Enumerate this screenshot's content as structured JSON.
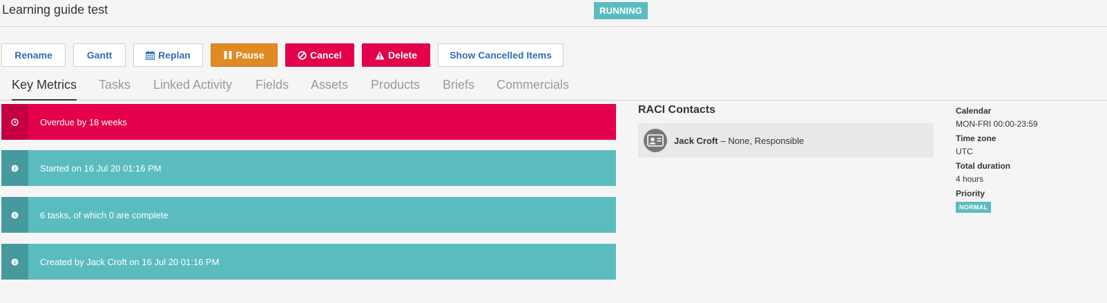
{
  "header": {
    "title": "Learning guide test",
    "status": "RUNNING"
  },
  "toolbar": {
    "rename": "Rename",
    "gantt": "Gantt",
    "replan": "Replan",
    "pause": "Pause",
    "cancel": "Cancel",
    "delete": "Delete",
    "show_cancelled": "Show Cancelled Items"
  },
  "tabs": [
    {
      "label": "Key Metrics",
      "active": true
    },
    {
      "label": "Tasks"
    },
    {
      "label": "Linked Activity"
    },
    {
      "label": "Fields"
    },
    {
      "label": "Assets"
    },
    {
      "label": "Products"
    },
    {
      "label": "Briefs"
    },
    {
      "label": "Commercials"
    }
  ],
  "metrics": [
    {
      "text": "Overdue by 18 weeks",
      "kind": "danger",
      "icon": "clock-icon"
    },
    {
      "text": "Started on 16 Jul 20 01:16 PM",
      "kind": "info",
      "icon": "info-icon"
    },
    {
      "text": "6 tasks, of which 0 are complete",
      "kind": "info",
      "icon": "info-icon"
    },
    {
      "text": "Created by Jack Croft on 16 Jul 20 01:16 PM",
      "kind": "info",
      "icon": "info-icon"
    }
  ],
  "raci": {
    "title": "RACI Contacts",
    "contact_name": "Jack Croft",
    "contact_role": "– None, Responsible"
  },
  "details": {
    "calendar_label": "Calendar",
    "calendar_value": "MON-FRI 00:00-23:59",
    "timezone_label": "Time zone",
    "timezone_value": "UTC",
    "duration_label": "Total duration",
    "duration_value": "4 hours",
    "priority_label": "Priority",
    "priority_value": "NORMAL"
  },
  "colors": {
    "accent": "#5bbcc0",
    "danger": "#e4004b",
    "warning": "#e08a23",
    "link": "#2f6db5"
  }
}
